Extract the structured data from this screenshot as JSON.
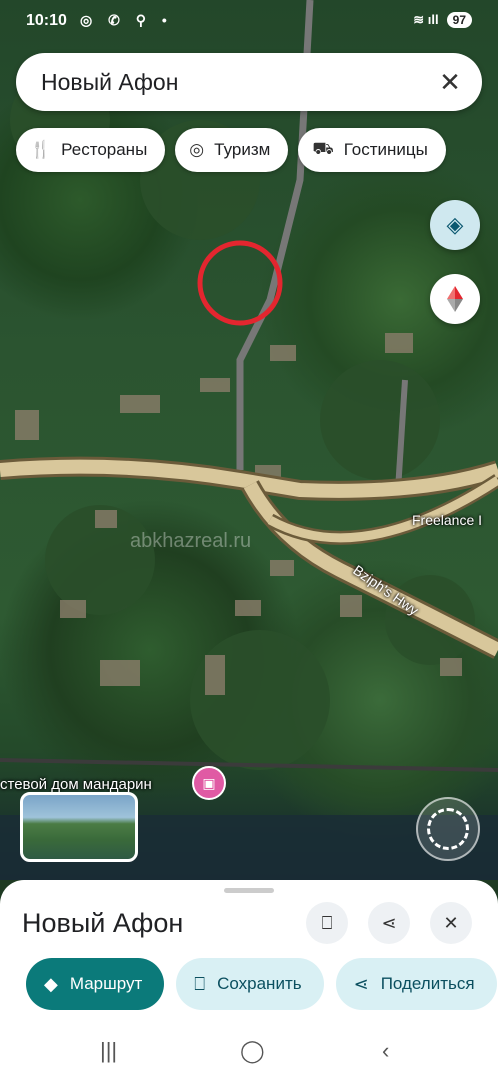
{
  "status_bar": {
    "time": "10:10",
    "icons": "◎ ✆ ⚲ •",
    "signal": "≋ ıll",
    "battery": "97"
  },
  "search": {
    "query": "Новый Афон",
    "clear_icon": "close-icon"
  },
  "chips": [
    {
      "icon": "restaurant-icon",
      "glyph": "🍴",
      "label": "Рестораны"
    },
    {
      "icon": "tourism-icon",
      "glyph": "◎",
      "label": "Туризм"
    },
    {
      "icon": "hotel-icon",
      "glyph": "⛟",
      "label": "Гостиницы"
    }
  ],
  "map": {
    "road_label_1": "Freelance I",
    "road_label_2": "Bziph's Hwy",
    "poi_label": "стевой дом мандарин",
    "watermark": "abkhazreal.ru"
  },
  "sheet": {
    "title": "Новый Афон",
    "route_label": "Маршрут",
    "save_label": "Сохранить",
    "share_label": "Поделиться"
  },
  "colors": {
    "primary": "#0b7a7a",
    "secondary": "#d9f0f4",
    "pin": "#e05aa4",
    "road": "#d8c79b"
  }
}
